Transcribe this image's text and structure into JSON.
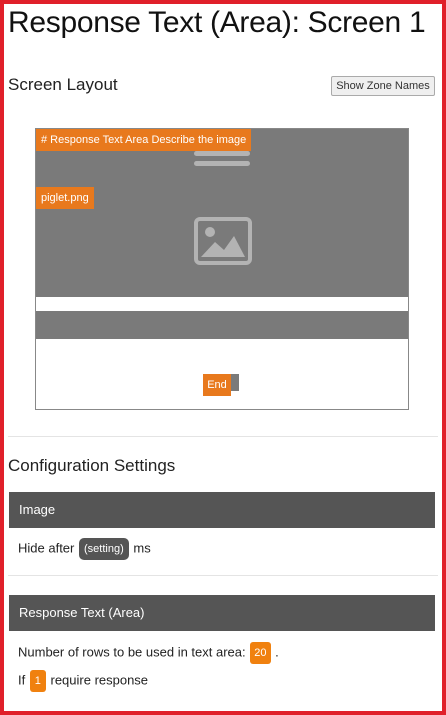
{
  "page": {
    "title": "Response Text (Area): Screen 1"
  },
  "screen_layout": {
    "heading": "Screen Layout",
    "zone_names_button": "Show Zone Names",
    "zones": {
      "description_tag": "# Response Text Area Describe the image",
      "image_tag": "piglet.png",
      "end_tag": "End"
    },
    "colors": {
      "zone_fill": "#7a7a7a",
      "tag": "#e8791d"
    },
    "icons": [
      "text-lines-icon",
      "image-placeholder-icon"
    ]
  },
  "configuration": {
    "heading": "Configuration Settings",
    "image_panel": {
      "title": "Image",
      "hide_prefix": "Hide after",
      "hide_value": "(setting)",
      "hide_suffix": "ms"
    },
    "response_panel": {
      "title": "Response Text (Area)",
      "rows_prefix": "Number of rows to be used in text area:",
      "rows_value": "20",
      "rows_suffix": ".",
      "require_prefix": "If",
      "require_value": "1",
      "require_suffix": "require response"
    },
    "colors": {
      "panel_header": "#555555",
      "value_pill": "#f0810f"
    }
  }
}
